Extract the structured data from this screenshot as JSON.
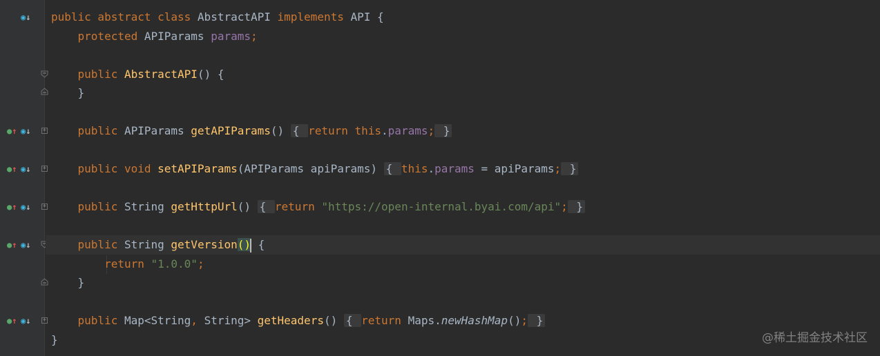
{
  "gutter_icons": {
    "override": "override-icon",
    "implemented": "implemented-icon",
    "fold": "fold-icon"
  },
  "colors": {
    "background": "#2b2b2b",
    "gutter": "#313335",
    "keyword": "#cc7832",
    "method": "#ffc66d",
    "field": "#9876aa",
    "string": "#6a8759",
    "text": "#a9b7c6"
  },
  "code": {
    "l1": {
      "kw1": "public abstract class ",
      "name": "AbstractAPI ",
      "kw2": "implements ",
      "rest": "API {"
    },
    "l2": {
      "kw": "protected ",
      "type": "APIParams ",
      "field": "params",
      "semi": ";"
    },
    "l3": {
      "kw": "public ",
      "name": "AbstractAPI",
      "rest": "() {"
    },
    "l4": {
      "rest": "}"
    },
    "l5": {
      "kw": "public ",
      "type": "APIParams ",
      "name": "getAPIParams",
      "parens": "()",
      "ob": "{ ",
      "ret": "return ",
      "this": "this",
      "dot": ".",
      "field": "params",
      "semi": ";",
      "cb": " }"
    },
    "l6": {
      "kw": "public void ",
      "name": "setAPIParams",
      "args": "(APIParams apiParams)",
      "ob": "{ ",
      "this": "this",
      "dot": ".",
      "field": "params",
      "assign": " = apiParams",
      "semi": ";",
      "cb": " }"
    },
    "l7": {
      "kw": "public ",
      "type": "String ",
      "name": "getHttpUrl",
      "parens": "()",
      "ob": "{ ",
      "ret": "return ",
      "str": "\"https://open-internal.byai.com/api\"",
      "semi": ";",
      "cb": " }"
    },
    "l8": {
      "kw": "public ",
      "type": "String ",
      "name": "getVersion",
      "p1": "(",
      "p2": ")",
      "rest": " {"
    },
    "l9": {
      "ret": "return ",
      "str": "\"1.0.0\"",
      "semi": ";"
    },
    "l10": {
      "rest": "}"
    },
    "l11": {
      "kw": "public ",
      "type": "Map<String",
      "comma": ", ",
      "type2": "String> ",
      "name": "getHeaders",
      "parens": "()",
      "ob": "{ ",
      "ret": "return ",
      "cls": "Maps.",
      "call": "newHashMap",
      "tail": "()",
      "semi": ";",
      "cb": " }"
    },
    "l12": {
      "rest": "}"
    }
  },
  "watermark": "@稀土掘金技术社区"
}
